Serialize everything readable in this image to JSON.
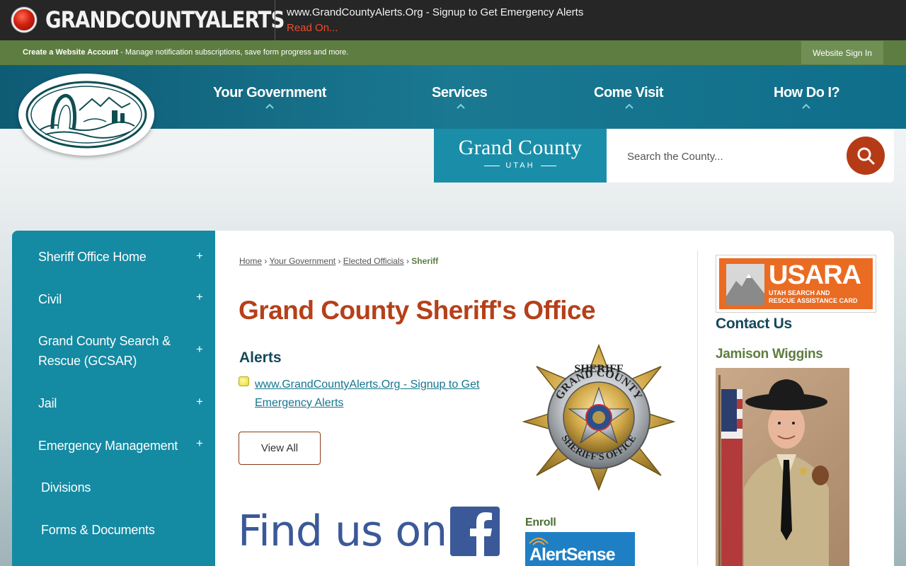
{
  "alert_bar": {
    "brand": "GRANDCOUNTYALERTS",
    "message": "www.GrandCountyAlerts.Org - Signup to Get Emergency Alerts",
    "read_on": "Read On..."
  },
  "account_bar": {
    "create_bold": "Create a Website Account",
    "create_rest": " - Manage notification subscriptions, save form progress and more.",
    "sign_in": "Website Sign In"
  },
  "nav": {
    "items": [
      "Your Government",
      "Services",
      "Come Visit",
      "How Do I?"
    ]
  },
  "brand": {
    "title": "Grand County",
    "subtitle": "UTAH"
  },
  "search": {
    "placeholder": "Search the County..."
  },
  "sidebar": {
    "items": [
      {
        "label": "Sheriff Office Home",
        "expandable": true
      },
      {
        "label": "Civil",
        "expandable": true
      },
      {
        "label": "Grand County Search & Rescue (GCSAR)",
        "expandable": true
      },
      {
        "label": "Jail",
        "expandable": true
      },
      {
        "label": "Emergency Management",
        "expandable": true
      },
      {
        "label": "Divisions",
        "expandable": false
      },
      {
        "label": "Forms & Documents",
        "expandable": false
      }
    ],
    "plus_symbol": "+"
  },
  "breadcrumb": {
    "items": [
      "Home",
      "Your Government",
      "Elected Officials"
    ],
    "current": "Sheriff",
    "separator": "›"
  },
  "main": {
    "title": "Grand County Sheriff's Office",
    "alerts_heading": "Alerts",
    "alert_link": "www.GrandCountyAlerts.Org - Signup to Get Emergency Alerts",
    "view_all": "View All",
    "find_us": "Find us on",
    "enroll": "Enroll",
    "alertsense": "AlertSense"
  },
  "badge": {
    "top": "SHERIFF",
    "arc": "GRAND COUNTY",
    "bottom": "SHERIFF'S OFFICE"
  },
  "right": {
    "usara_title": "USARA",
    "usara_sub_1": "UTAH SEARCH AND",
    "usara_sub_2": "RESCUE ASSISTANCE CARD",
    "contact_heading": "Contact Us",
    "person_name": "Jamison Wiggins"
  },
  "colors": {
    "teal": "#148aa3",
    "olive": "#5e7d41",
    "accent": "#b5401a"
  }
}
